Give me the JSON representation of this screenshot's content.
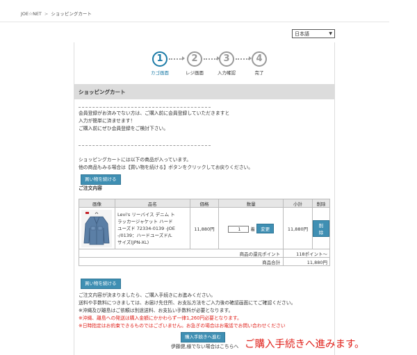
{
  "breadcrumb": {
    "home": "JOE☆NET",
    "sep": ">",
    "current": "ショッピングカート"
  },
  "language": {
    "selected": "日本語"
  },
  "steps": [
    {
      "num": "1",
      "label": "カゴ画面"
    },
    {
      "num": "2",
      "label": "レジ画面"
    },
    {
      "num": "3",
      "label": "入力確認"
    },
    {
      "num": "4",
      "label": "完了"
    }
  ],
  "section_title": "ショッピングカート",
  "dashes": "---------------------------------------------------------------------------",
  "member_notice": [
    "会員登録がお済みでない方は、ご購入前に会員登録していただきますと",
    "入力が簡単に済ませます！",
    "ご購入前にぜひ会員登録をご検討下さい。"
  ],
  "cart_notice": [
    "ショッピングカートには以下の商品が入っています。",
    "他の商品もみる場合は【買い物を続ける】ボタンをクリックしてお戻りください。"
  ],
  "continue_button": "買い物を続ける",
  "order_heading": "ご注文内容",
  "table": {
    "headers": [
      "画像",
      "品名",
      "価格",
      "数量",
      "小計",
      "削除"
    ],
    "item": {
      "name_lines": [
        "Levi's リーバイス デニム ト",
        "ラッカージャケット ハード",
        "ユーズド 72334-0139 -JOE",
        "-/0139：ハードユーズド/L",
        "サイズ(JPN-XL)"
      ],
      "price": "11,880円",
      "qty": "1",
      "unit": "着",
      "change": "変更",
      "subtotal": "11,880円",
      "delete": "削除"
    },
    "points_label": "商品の還元ポイント",
    "points_value": "118ポイント〜",
    "total_label": "商品合計",
    "total_value": "11,880円"
  },
  "bottom_notice": [
    "ご注文内容が決まりましたら、ご購入手続きにお進みください。",
    "送料や手数料につきましては、お届け先住所、お支払方法をご入力後の確認画面にてご確認ください。",
    "※沖縄及び離島はご依頼は別途送料、お支払い手数料が必要となります。"
  ],
  "red_notice": [
    "※沖縄、離島への発送は購入金額にかかわらず一律1,260円必要となります。",
    "※日時指定はお約束できるものではございません。お急ぎの場合はお電話でお問い合わせください"
  ],
  "checkout_button": "購入手続きへ進む",
  "non_member_link": "伊藤健,様でない場合はこちらへ",
  "annotation": "ご購入手続きへ進みます。"
}
